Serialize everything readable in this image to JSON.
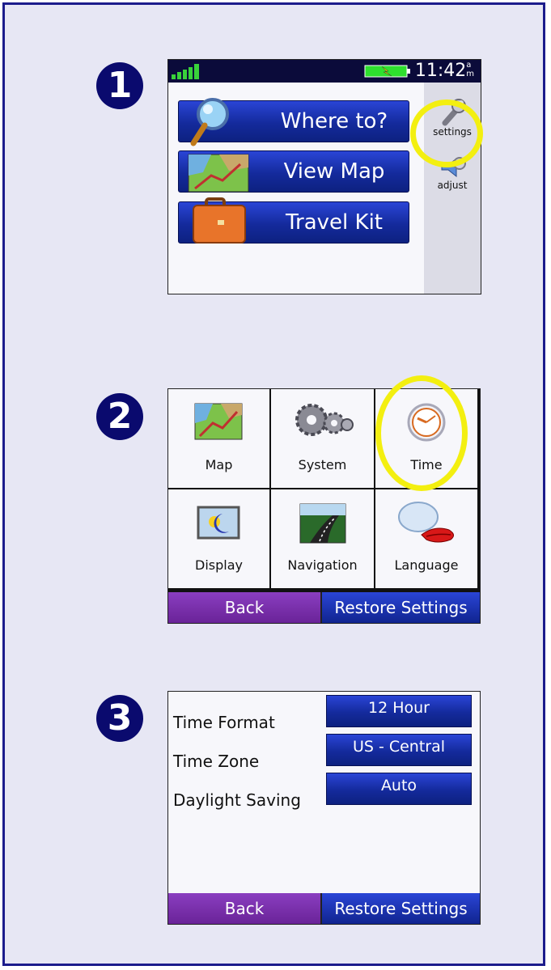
{
  "steps": [
    "1",
    "2",
    "3"
  ],
  "screen1": {
    "time": "11:42",
    "ampm_top": "a",
    "ampm_bottom": "m",
    "buttons": [
      {
        "label": "Where to?",
        "icon": "magnifier-icon"
      },
      {
        "label": "View Map",
        "icon": "map-icon"
      },
      {
        "label": "Travel Kit",
        "icon": "suitcase-icon"
      }
    ],
    "side": [
      {
        "label": "settings",
        "icon": "wrench-icon"
      },
      {
        "label": "adjust",
        "icon": "speaker-icon"
      }
    ]
  },
  "screen2": {
    "cells": [
      {
        "label": "Map",
        "icon": "map-icon"
      },
      {
        "label": "System",
        "icon": "gears-icon"
      },
      {
        "label": "Time",
        "icon": "clock-icon"
      },
      {
        "label": "Display",
        "icon": "display-icon"
      },
      {
        "label": "Navigation",
        "icon": "road-icon"
      },
      {
        "label": "Language",
        "icon": "speech-lips-icon"
      }
    ],
    "back": "Back",
    "restore": "Restore Settings"
  },
  "screen3": {
    "rows": [
      {
        "label": "Time Format",
        "value": "12 Hour"
      },
      {
        "label": "Time Zone",
        "value": "US - Central"
      },
      {
        "label": "Daylight Saving",
        "value": "Auto"
      }
    ],
    "back": "Back",
    "restore": "Restore Settings"
  },
  "colors": {
    "page_bg": "#e7e7f4",
    "border": "#1c1c8c",
    "button_blue": "#142a9c",
    "back_purple": "#7a2fae",
    "highlight": "#f3ef10"
  }
}
